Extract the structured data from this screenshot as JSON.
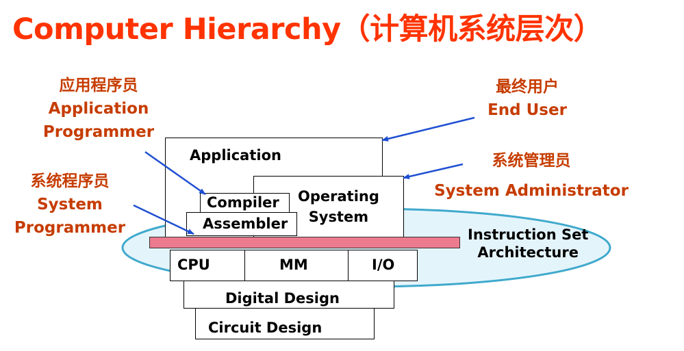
{
  "title": "Computer Hierarchy（计算机系统层次）",
  "layers": {
    "application": "Application",
    "operating_system": [
      "Operating",
      "System"
    ],
    "compiler": "Compiler",
    "assembler": "Assembler",
    "cpu": "CPU",
    "mm": "MM",
    "io": "I/O",
    "digital_design": "Digital Design",
    "circuit_design": "Circuit Design"
  },
  "isa": [
    "Instruction Set",
    "Architecture"
  ],
  "roles": {
    "application_programmer": [
      "应用程序员",
      "Application",
      "Programmer"
    ],
    "system_programmer": [
      "系统程序员",
      "System",
      "Programmer"
    ],
    "end_user": [
      "最终用户",
      "End User"
    ],
    "system_administrator": [
      "系统管理员",
      "System Administrator"
    ]
  },
  "colors": {
    "title": "#ff3300",
    "role_text": "#c63c00",
    "arrow": "#1f4fd1",
    "isa_bar": "#ec7b8f",
    "isa_ellipse_fill": "#e4f4fb",
    "isa_ellipse_stroke": "#3fa9cc"
  }
}
